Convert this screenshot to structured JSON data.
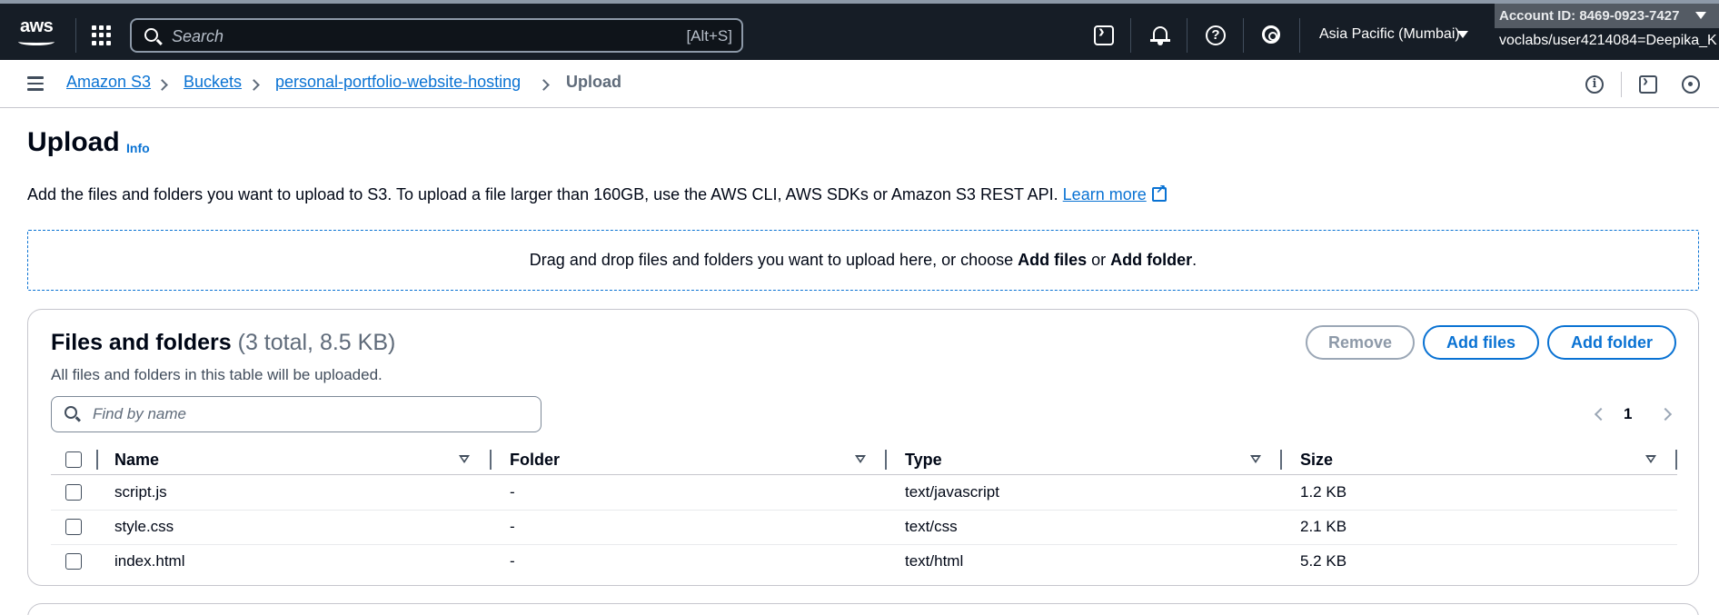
{
  "topnav": {
    "logo": "aws",
    "search_placeholder": "Search",
    "search_shortcut": "[Alt+S]",
    "region": "Asia Pacific (Mumbai)",
    "account_id": "Account ID: 8469-0923-7427",
    "account_user": "voclabs/user4214084=Deepika_K",
    "icons": [
      "apps-grid-icon",
      "cloudshell-icon",
      "bell-icon",
      "help-icon",
      "gear-icon"
    ]
  },
  "breadcrumb": {
    "items": [
      "Amazon S3",
      "Buckets",
      "personal-portfolio-website-hosting",
      "Upload"
    ]
  },
  "header": {
    "title": "Upload",
    "info": "Info",
    "description": "Add the files and folders you want to upload to S3. To upload a file larger than 160GB, use the AWS CLI, AWS SDKs or Amazon S3 REST API.",
    "learn_more": "Learn more"
  },
  "dropzone": {
    "text_before": "Drag and drop files and folders you want to upload here, or choose ",
    "add_files": "Add files",
    "or": " or ",
    "add_folder": "Add folder",
    "period": "."
  },
  "files_panel": {
    "title": "Files and folders",
    "count": "(3 total, 8.5 KB)",
    "subtitle": "All files and folders in this table will be uploaded.",
    "remove_label": "Remove",
    "add_files_label": "Add files",
    "add_folder_label": "Add folder",
    "filter_placeholder": "Find by name",
    "page": "1",
    "columns": [
      "Name",
      "Folder",
      "Type",
      "Size"
    ],
    "rows": [
      {
        "name": "script.js",
        "folder": "-",
        "type": "text/javascript",
        "size": "1.2 KB"
      },
      {
        "name": "style.css",
        "folder": "-",
        "type": "text/css",
        "size": "2.1 KB"
      },
      {
        "name": "index.html",
        "folder": "-",
        "type": "text/html",
        "size": "5.2 KB"
      }
    ]
  },
  "colors": {
    "nav_bg": "#161d26",
    "link": "#0972d3",
    "text": "#000716",
    "border": "#c6c6cd"
  }
}
